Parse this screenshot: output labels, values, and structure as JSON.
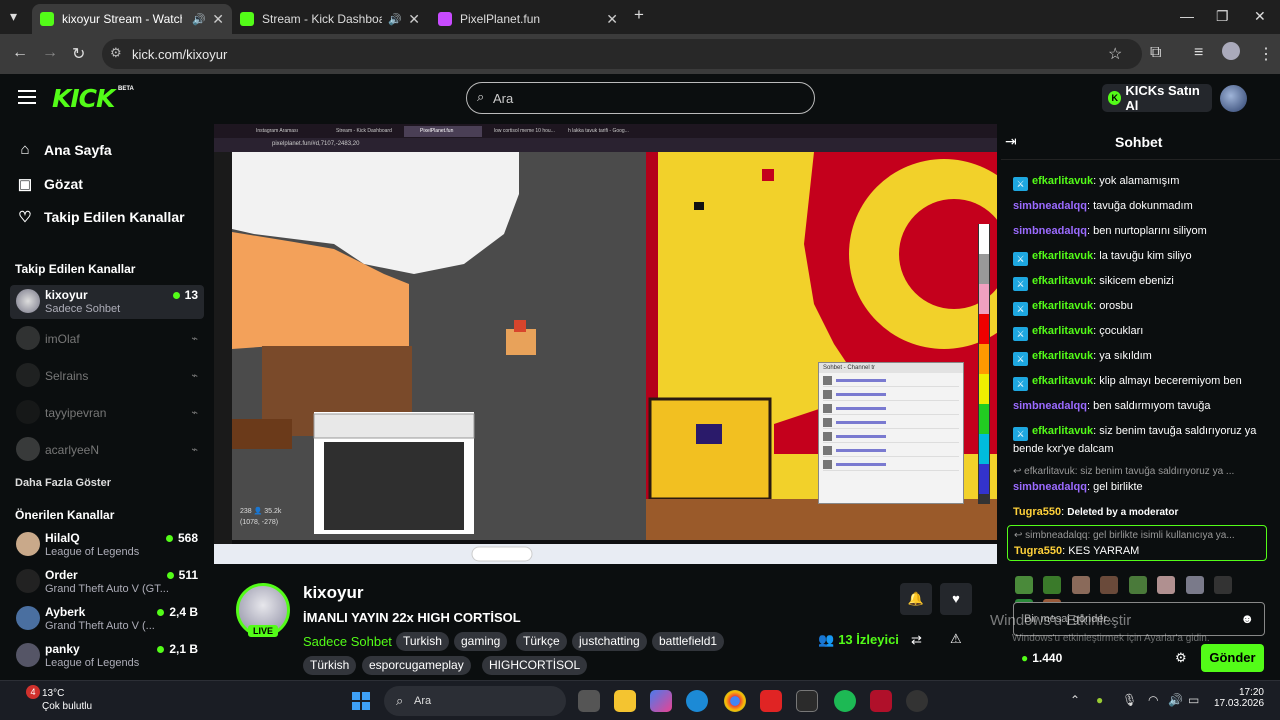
{
  "browser": {
    "tabs": [
      {
        "title": "kixoyur Stream - Watch Live",
        "color": "#53fc18",
        "active": true
      },
      {
        "title": "Stream - Kick Dashboard",
        "color": "#53fc18",
        "active": false
      },
      {
        "title": "PixelPlanet.fun",
        "color": "#c84bff",
        "active": false
      }
    ],
    "new_tab": "+",
    "url": "kick.com/kixoyur"
  },
  "header": {
    "logo": "KICK",
    "beta": "BETA",
    "search_placeholder": "Ara",
    "kicks_button": "KICKs Satın Al"
  },
  "sidebar": {
    "nav": [
      {
        "label": "Ana Sayfa",
        "icon": "home-icon"
      },
      {
        "label": "Gözat",
        "icon": "browse-icon"
      },
      {
        "label": "Takip Edilen Kanallar",
        "icon": "heart-icon"
      }
    ],
    "followed_title": "Takip Edilen Kanallar",
    "followed": [
      {
        "name": "kixoyur",
        "sub": "Sadece Sohbet",
        "count": "13",
        "live": true
      },
      {
        "name": "imOlaf",
        "live": false
      },
      {
        "name": "Selrains",
        "live": false
      },
      {
        "name": "tayyipevran",
        "live": false
      },
      {
        "name": "acarlyeeN",
        "live": false
      }
    ],
    "more": "Daha Fazla Göster",
    "recommended_title": "Önerilen Kanallar",
    "recommended": [
      {
        "name": "HilalQ",
        "sub": "League of Legends",
        "count": "568"
      },
      {
        "name": "Order",
        "sub": "Grand Theft Auto V (GT...",
        "count": "511"
      },
      {
        "name": "Ayberk",
        "sub": "Grand Theft Auto V (...",
        "count": "2,4 B"
      },
      {
        "name": "panky",
        "sub": "League of Legends",
        "count": "2,1 B"
      }
    ]
  },
  "stream": {
    "name": "kixoyur",
    "live": "LIVE",
    "title": "İMANLI YAYIN 22x HIGH CORTİSOL",
    "category": "Sadece Sohbet",
    "tags": [
      "Turkish",
      "gaming",
      "Türkçe",
      "justchatting",
      "battlefield1",
      "Türkish",
      "esporcugameplay",
      "HIGHCORTİSOL"
    ],
    "viewers": "13",
    "viewers_label": "İzleyici"
  },
  "chat": {
    "title": "Sohbet",
    "messages": [
      {
        "user": "efkarlitavuk",
        "text": "yok alamamışım",
        "style": "u1",
        "badge": true
      },
      {
        "user": "simbneadalqq",
        "text": "tavuğa dokunmadım",
        "style": "u2",
        "badge": false
      },
      {
        "user": "simbneadalqq",
        "text": "ben nurtoplarını siliyom",
        "style": "u2",
        "badge": false
      },
      {
        "user": "efkarlitavuk",
        "text": "la tavuğu kim siliyo",
        "style": "u1",
        "badge": true
      },
      {
        "user": "efkarlitavuk",
        "text": "sikicem ebenizi",
        "style": "u1",
        "badge": true
      },
      {
        "user": "efkarlitavuk",
        "text": "orosbu",
        "style": "u1",
        "badge": true
      },
      {
        "user": "efkarlitavuk",
        "text": "çocukları",
        "style": "u1",
        "badge": true
      },
      {
        "user": "efkarlitavuk",
        "text": "ya sıkıldım",
        "style": "u1",
        "badge": true
      },
      {
        "user": "efkarlitavuk",
        "text": "klip almayı beceremiyom ben",
        "style": "u1",
        "badge": true
      },
      {
        "user": "simbneadalqq",
        "text": "ben saldırmıyom tavuğa",
        "style": "u2",
        "badge": false
      },
      {
        "user": "efkarlitavuk",
        "text": "siz benim tavuğa saldırıyoruz ya bende kxr'ye dalcam",
        "style": "u1",
        "badge": true
      }
    ],
    "reply1": "efkarlitavuk: siz benim tavuğa saldırıyoruz ya ...",
    "msg_after_reply1": {
      "user": "simbneadalqq",
      "text": "gel birlikte"
    },
    "deleted": {
      "user": "Tugra550",
      "text": "Deleted by a moderator"
    },
    "reply2": "simbneadalqq: gel birlikte isimli kullanıcıya ya...",
    "msg_after_reply2": {
      "user": "Tugra550",
      "text": "KES YARRAM"
    },
    "input_placeholder": "Bir mesaj gönder...",
    "points": "1.440",
    "send": "Gönder",
    "watermark1": "Windows'u Etkinleştir",
    "watermark2": "Windows'u etkinleştirmek için Ayarlar'a gidin."
  },
  "video": {
    "inner_tabs": [
      "Instagram Araması",
      "Stream - Kick Dashboard",
      "PixelPlanet.fun",
      "low cortisol meme 10 hou...",
      "h lakka tavuk tarifi - Goog..."
    ],
    "inner_url": "pixelplanet.fun/#d,7107,-2483,20",
    "coords": "(1078, -278)",
    "counter": "238 👤 35.2k",
    "inner_chat_title": "Sohbet - Channel tr"
  },
  "taskbar": {
    "notif": "4",
    "temp": "13°C",
    "weather": "Çok bulutlu",
    "search": "Ara",
    "time": "17:20",
    "date": "17.03.2026"
  },
  "colors": {
    "accent": "#53fc18",
    "bg": "#0b0e0f"
  }
}
